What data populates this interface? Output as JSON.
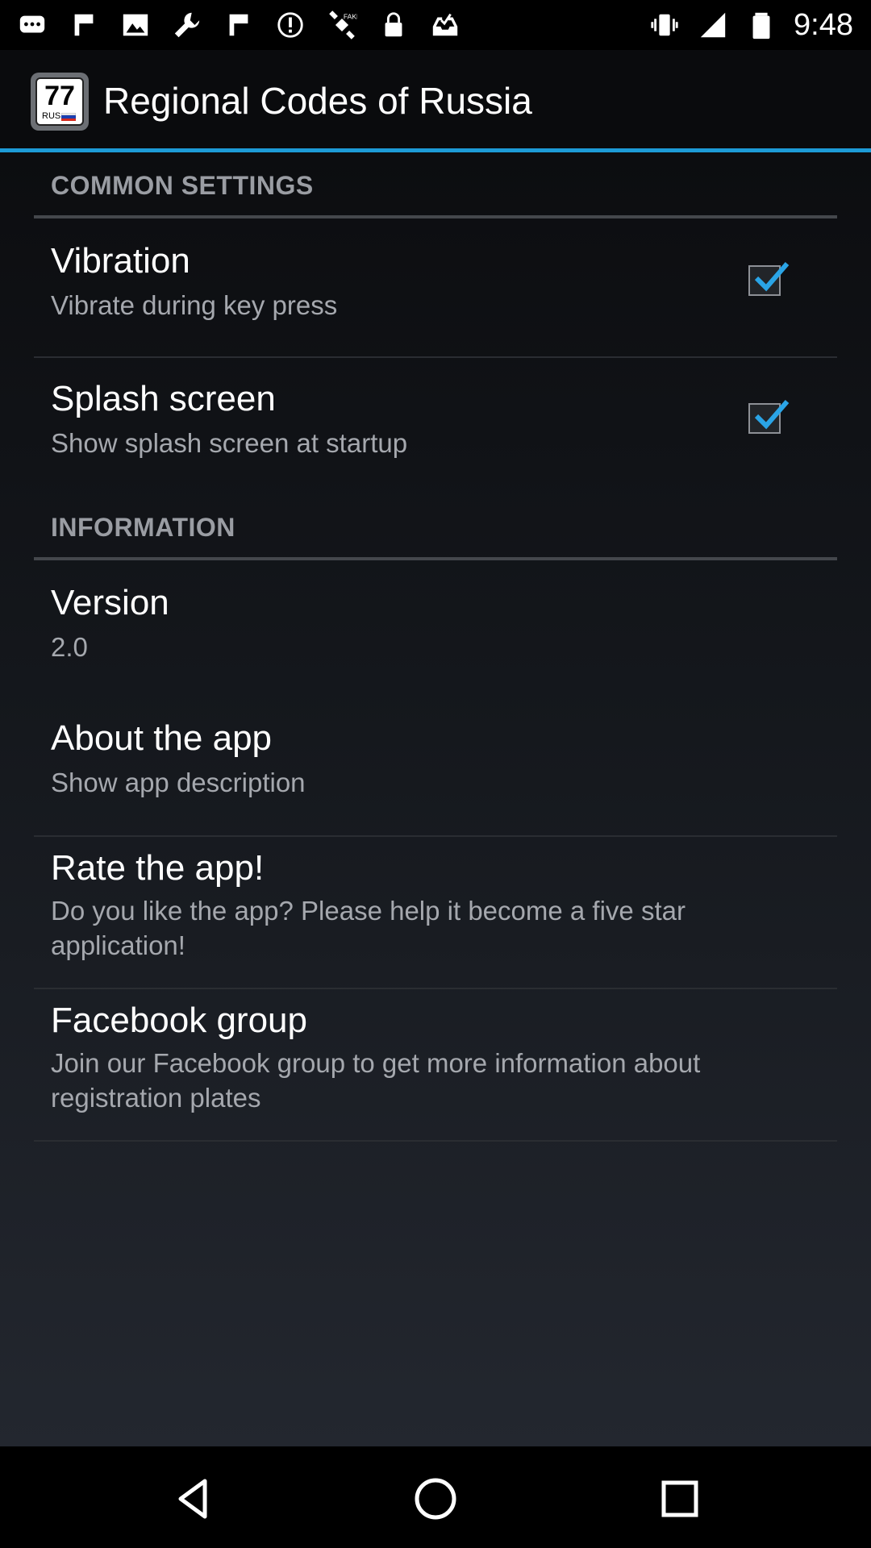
{
  "status_bar": {
    "time": "9:48",
    "left_icons": [
      "messages-icon",
      "bookmark-icon",
      "image-icon",
      "wrench-icon",
      "bookmark-icon",
      "alert-icon",
      "satellite-icon",
      "lock-icon",
      "tray-check-icon"
    ],
    "right_icons": [
      "vibrate-icon",
      "signal-icon",
      "battery-icon"
    ]
  },
  "action_bar": {
    "app_icon": {
      "number": "77",
      "region": "RUS"
    },
    "title": "Regional Codes of Russia",
    "accent_color": "#1d9bd6"
  },
  "sections": {
    "common": {
      "header": "COMMON SETTINGS",
      "vibration": {
        "title": "Vibration",
        "subtitle": "Vibrate during key press",
        "checked": true
      },
      "splash": {
        "title": "Splash screen",
        "subtitle": "Show splash screen at startup",
        "checked": true
      }
    },
    "information": {
      "header": "INFORMATION",
      "version": {
        "title": "Version",
        "subtitle": "2.0"
      },
      "about": {
        "title": "About the app",
        "subtitle": "Show app description"
      },
      "rate": {
        "title": "Rate the app!",
        "subtitle": "Do you like the app? Please help it become a five star application!"
      },
      "facebook": {
        "title": "Facebook group",
        "subtitle": "Join our Facebook group to get more information about registration plates"
      }
    }
  },
  "nav_bar": {
    "buttons": [
      "back-icon",
      "home-icon",
      "recents-icon"
    ]
  }
}
